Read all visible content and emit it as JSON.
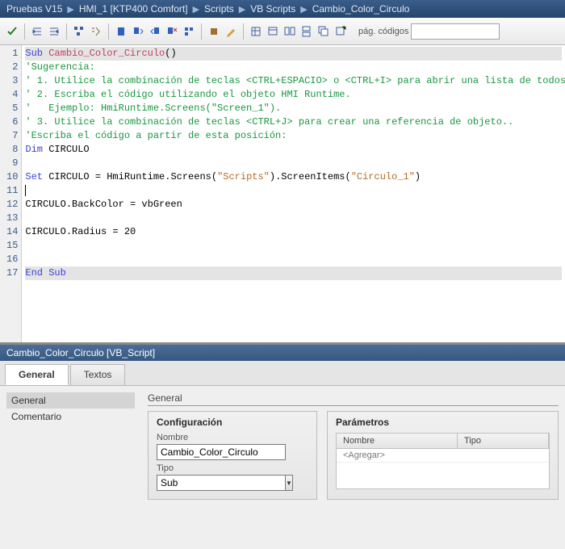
{
  "breadcrumb": [
    "Pruebas V15",
    "HMI_1 [KTP400 Comfort]",
    "Scripts",
    "VB Scripts",
    "Cambio_Color_Circulo"
  ],
  "toolbar": {
    "pages_label": "pág. códigos",
    "pages_value": ""
  },
  "code": {
    "lines": [
      {
        "n": 1,
        "cls": "hl-line",
        "tokens": [
          {
            "t": "Sub ",
            "c": "keyword"
          },
          {
            "t": "Cambio_Color_Circulo",
            "c": "subname"
          },
          {
            "t": "()"
          }
        ]
      },
      {
        "n": 2,
        "tokens": [
          {
            "t": "'Sugerencia:",
            "c": "comment"
          }
        ]
      },
      {
        "n": 3,
        "tokens": [
          {
            "t": "' 1. Utilice la combinación de teclas <CTRL+ESPACIO> o <CTRL+I> para abrir una lista de todos",
            "c": "comment"
          }
        ]
      },
      {
        "n": 4,
        "tokens": [
          {
            "t": "' 2. Escriba el código utilizando el objeto HMI Runtime.",
            "c": "comment"
          }
        ]
      },
      {
        "n": 5,
        "tokens": [
          {
            "t": "'   Ejemplo: HmiRuntime.Screens(\"Screen_1\").",
            "c": "comment"
          }
        ]
      },
      {
        "n": 6,
        "tokens": [
          {
            "t": "' 3. Utilice la combinación de teclas <CTRL+J> para crear una referencia de objeto..",
            "c": "comment"
          }
        ]
      },
      {
        "n": 7,
        "tokens": [
          {
            "t": "'Escriba el código a partir de esta posición:",
            "c": "comment"
          }
        ]
      },
      {
        "n": 8,
        "tokens": [
          {
            "t": "Dim",
            "c": "keyword"
          },
          {
            "t": " CIRCULO"
          }
        ]
      },
      {
        "n": 9,
        "tokens": []
      },
      {
        "n": 10,
        "tokens": [
          {
            "t": "Set",
            "c": "keyword"
          },
          {
            "t": " CIRCULO = HmiRuntime.Screens("
          },
          {
            "t": "\"Scripts\"",
            "c": "string"
          },
          {
            "t": ").ScreenItems("
          },
          {
            "t": "\"Circulo_1\"",
            "c": "string"
          },
          {
            "t": ")"
          }
        ]
      },
      {
        "n": 11,
        "caret": true,
        "tokens": []
      },
      {
        "n": 12,
        "tokens": [
          {
            "t": "CIRCULO.BackColor = vbGreen"
          }
        ]
      },
      {
        "n": 13,
        "tokens": []
      },
      {
        "n": 14,
        "tokens": [
          {
            "t": "CIRCULO.Radius = 20"
          }
        ]
      },
      {
        "n": 15,
        "tokens": []
      },
      {
        "n": 16,
        "tokens": []
      },
      {
        "n": 17,
        "cls": "hl-line",
        "tokens": [
          {
            "t": "End Sub",
            "c": "keyword"
          }
        ]
      }
    ]
  },
  "panel": {
    "title": "Cambio_Color_Circulo [VB_Script]",
    "tabs": [
      {
        "label": "General",
        "active": true
      },
      {
        "label": "Textos",
        "active": false
      }
    ],
    "sidebar": [
      {
        "label": "General",
        "selected": true
      },
      {
        "label": "Comentario",
        "selected": false
      }
    ],
    "section_title": "General",
    "config": {
      "group_title": "Configuración",
      "name_label": "Nombre",
      "name_value": "Cambio_Color_Circulo",
      "type_label": "Tipo",
      "type_value": "Sub"
    },
    "params": {
      "group_title": "Parámetros",
      "col_name": "Nombre",
      "col_type": "Tipo",
      "add_placeholder": "<Agregar>"
    }
  }
}
